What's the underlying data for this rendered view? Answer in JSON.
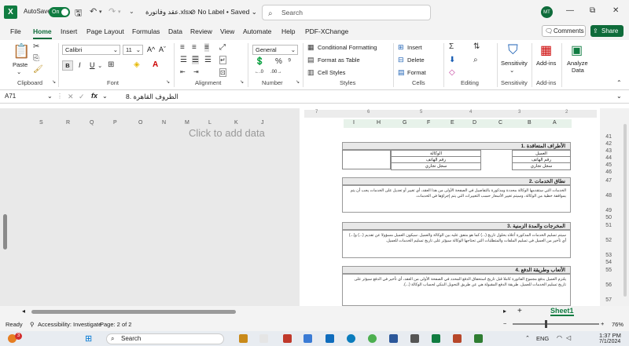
{
  "titlebar": {
    "logo": "X",
    "autosave_label": "AutoSave",
    "autosave_state": "On",
    "filename": "عقد وفاتورة.xlsx",
    "label_status": "No Label",
    "save_status": "Saved",
    "search_placeholder": "Search",
    "avatar_initials": "MT"
  },
  "menu": [
    "File",
    "Home",
    "Insert",
    "Page Layout",
    "Formulas",
    "Data",
    "Review",
    "View",
    "Automate",
    "Help",
    "PDF-XChange"
  ],
  "menu_active": "Home",
  "comments_label": "Comments",
  "share_label": "Share",
  "ribbon": {
    "clipboard": {
      "paste": "Paste",
      "label": "Clipboard"
    },
    "font": {
      "name": "Calibri",
      "size": "11",
      "bold": "B",
      "italic": "I",
      "underline": "U",
      "label": "Font"
    },
    "alignment": {
      "label": "Alignment"
    },
    "number": {
      "format": "General",
      "label": "Number"
    },
    "styles": {
      "conditional": "Conditional Formatting",
      "format_table": "Format as Table",
      "cell_styles": "Cell Styles",
      "label": "Styles"
    },
    "cells": {
      "insert": "Insert",
      "delete": "Delete",
      "format": "Format",
      "label": "Cells"
    },
    "editing": {
      "label": "Editing"
    },
    "sensitivity": {
      "btn": "Sensitivity",
      "label": "Sensitivity"
    },
    "addins": {
      "btn": "Add-ins",
      "label": "Add-ins"
    },
    "analyze": {
      "btn1": "Analyze",
      "btn2": "Data"
    }
  },
  "formulabar": {
    "name_box": "A71",
    "formula": "8. الظروف القاهرة"
  },
  "sheet": {
    "left_columns": [
      "S",
      "R",
      "Q",
      "P",
      "O",
      "N",
      "M",
      "L",
      "K",
      "J"
    ],
    "right_columns": [
      "I",
      "H",
      "G",
      "F",
      "E",
      "D",
      "C",
      "B",
      "A"
    ],
    "placeholder": "Click to add data",
    "row_numbers": [
      "41",
      "42",
      "43",
      "44",
      "45",
      "46",
      "47",
      "48",
      "49",
      "50",
      "51",
      "52",
      "53",
      "54",
      "55",
      "56",
      "57"
    ],
    "sections": [
      {
        "title": "1. الأطراف المتعاقدة"
      },
      {
        "title": "2. نطاق الخدمات",
        "body": "الخدمات التي ستقدمها الوكالة محددة ومذكورة بالتفاصيل في الصفحة الأولى من هذا العقد، أي تغيير أو تعديل على الخدمات يجب أن يتم بموافقة خطية من الوكالة، وسيتم تغيير الأسعار حسب التغييرات التي يتم إجراؤها في الخدمات."
      },
      {
        "title": "3. المخرجات والمدة الزمنية",
        "body": "سيتم تسليم الخدمات المذكورة أعلاه بحلول تاريخ (...) كما هو متفق عليه بين الوكالة والعميل. سيكون العميل مسؤولا عن تقديم (...) و(...) أي تأخير من العميل في تسليم الملفات والمتطلبات التي تحتاجها الوكالة سيؤثر على تاريخ تسليم الخدمات للعميل."
      },
      {
        "title": "4. الأتعاب وطريقة الدفع",
        "body": "يلتزم العميل بدفع مجموع الفاتورة كاملا قبل تاريخ استحقاق الدفع المحدد في الصفحة الأولى من العقد، أي تأخير في الدفع سيؤثر على تاريخ تسليم الخدمات للعميل. طريقة الدفع المقبولة هي عن طريق التحويل البنكي لحساب الوكالة (...)."
      }
    ],
    "party_cells": {
      "client": "العميل",
      "client_phone": "رقم الهاتف",
      "client_cr": "سجل تجاري",
      "agency": "الوكالة",
      "agency_phone": "رقم الهاتف",
      "agency_cr": "سجل تجاري"
    }
  },
  "sheet_tab": "Sheet1",
  "status": {
    "ready": "Ready",
    "accessibility": "Accessibility: Investigate",
    "page": "Page: 2 of 2",
    "zoom": "76%"
  },
  "taskbar": {
    "search": "Search",
    "lang": "ENG",
    "time": "1:37 PM",
    "date": "7/1/2024",
    "badge": "3"
  }
}
